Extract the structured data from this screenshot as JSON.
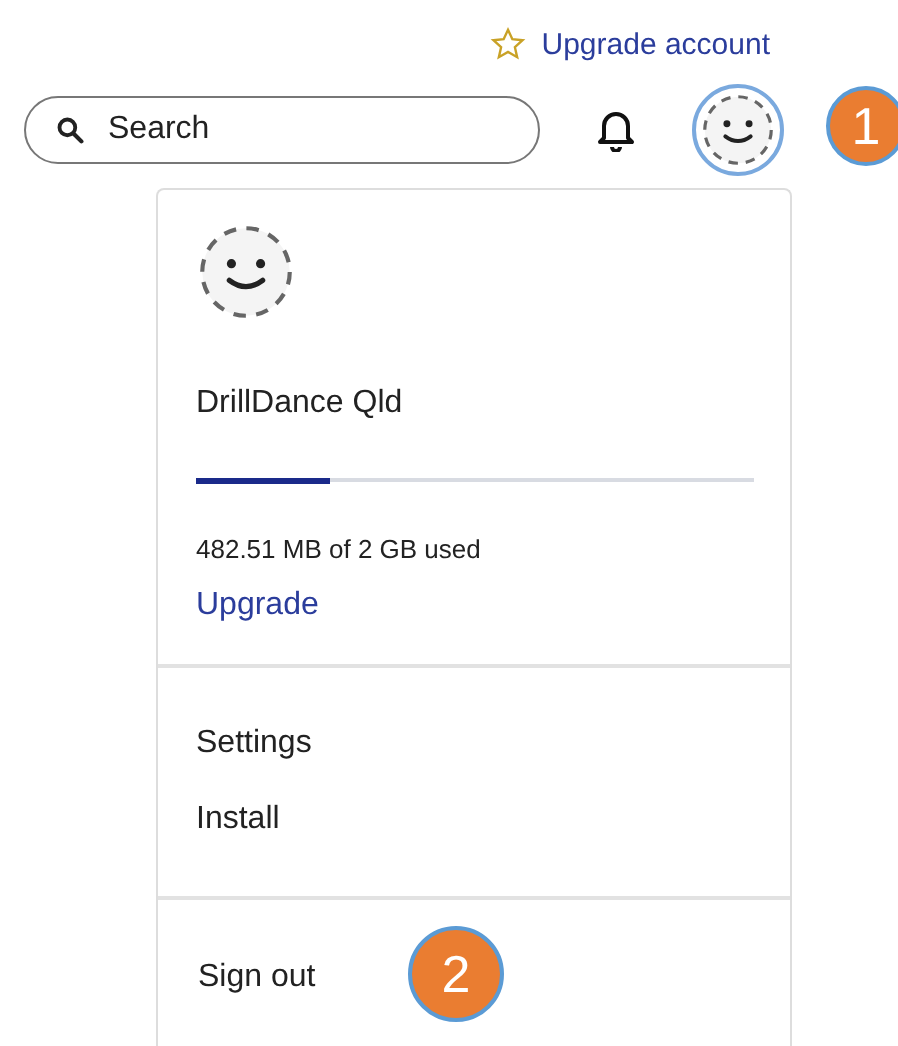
{
  "header": {
    "upgrade_link": "Upgrade account",
    "search": {
      "placeholder": "Search"
    }
  },
  "menu": {
    "name": "DrillDance Qld",
    "storage": {
      "level": 0.24,
      "text": "482.51 MB of 2 GB used"
    },
    "upgrade_link": "Upgrade",
    "items": [
      "Settings",
      "Install"
    ],
    "sign_out": "Sign out"
  },
  "callouts": [
    "1",
    "2"
  ]
}
